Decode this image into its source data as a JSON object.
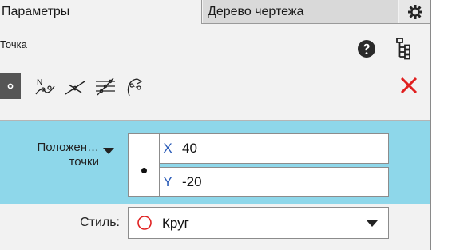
{
  "tabs": {
    "params_label": "Параметры",
    "tree_label": "Дерево чертежа",
    "settings_icon": "gear-icon"
  },
  "header": {
    "subtitle": "Точка",
    "help_icon": "question-circle-icon",
    "tree_icon": "hierarchy-tree-icon"
  },
  "toolbar": {
    "tools": [
      {
        "name": "point-tool",
        "icon": "point-icon",
        "active": true
      },
      {
        "name": "point-on-curve-tool",
        "icon": "point-on-curve-icon",
        "active": false
      },
      {
        "name": "intersection-points-tool",
        "icon": "intersection-icon",
        "active": false
      },
      {
        "name": "points-along-curve-tool",
        "icon": "points-along-curve-icon",
        "active": false
      },
      {
        "name": "point-at-distance-tool",
        "icon": "point-at-distance-icon",
        "active": false
      }
    ],
    "close_icon": "close-icon",
    "close_color": "#e02020"
  },
  "position": {
    "label": "Положен… точки",
    "x_tag": "X",
    "x_value": "40",
    "y_tag": "Y",
    "y_value": "-20"
  },
  "style": {
    "label": "Стиль:",
    "value": "Круг",
    "icon": "circle-style-icon",
    "icon_color": "#e02020"
  },
  "colors": {
    "accent_band": "#8ed7ea",
    "panel_bg": "#f2f2f2",
    "tab_inactive": "#d9d9d9",
    "coord_tag": "#2b5cb8"
  }
}
